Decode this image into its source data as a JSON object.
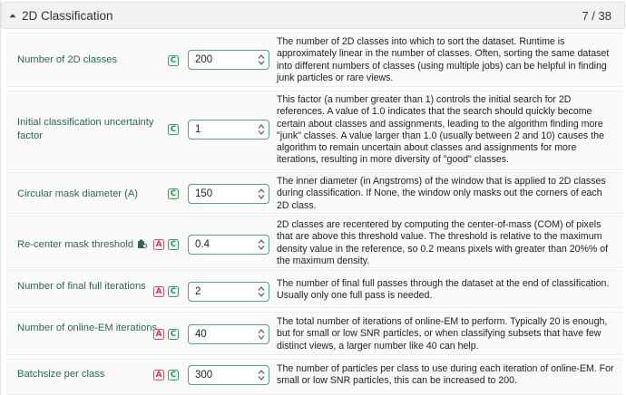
{
  "section": {
    "title": "2D Classification",
    "count": "7 / 38"
  },
  "params": [
    {
      "label": "Number of 2D classes",
      "value": "200",
      "badges": [
        "C"
      ],
      "description": "The number of 2D classes into which to sort the dataset. Runtime is approximately linear in the number of classes. Often, sorting the same dataset into different numbers of classes (using multiple jobs) can be helpful in finding junk particles or rare views."
    },
    {
      "label": "Initial classification uncertainty factor",
      "value": "1",
      "badges": [
        "C"
      ],
      "description": "This factor (a number greater than 1) controls the initial search for 2D references. A value of 1.0 indicates that the search should quickly become certain about classes and assignments, leading to the algorithm finding more \"junk\" classes. A value larger than 1.0 (usually between 2 and 10) causes the algorithm to remain uncertain about classes and assignments for more iterations, resulting in more diversity of \"good\" classes."
    },
    {
      "label": "Circular mask diameter (A)",
      "value": "150",
      "badges": [
        "C"
      ],
      "description": "The inner diameter (in Angstroms) of the window that is applied to 2D classes during classification. If None, the window only masks out the corners of each 2D class."
    },
    {
      "label": "Re-center mask threshold",
      "value": "0.4",
      "badges": [
        "A",
        "C"
      ],
      "description": "2D classes are recentered by computing the center-of-mass (COM) of pixels that are above this threshold value. The threshold is relative to the maximum density value in the reference, so 0.2 means pixels with greater than 20%% of the maximum density."
    },
    {
      "label": "Number of final full iterations",
      "value": "2",
      "badges": [
        "A",
        "C"
      ],
      "description": "The number of final full passes through the dataset at the end of classification. Usually only one full pass is needed."
    },
    {
      "label": "Number of online-EM iterations",
      "value": "40",
      "badges": [
        "A",
        "C"
      ],
      "description": "The total number of iterations of online-EM to perform. Typically 20 is enough, but for small or low SNR particles, or when classifying subsets that have few distinct views, a larger number like 40 can help."
    },
    {
      "label": "Batchsize per class",
      "value": "300",
      "badges": [
        "A",
        "C"
      ],
      "description": "The number of particles per class to use during each iteration of online-EM. For small or low SNR particles, this can be increased to 200."
    }
  ],
  "colors": {
    "label_green": "#2c6a4b",
    "badge_c": "#2e8b50",
    "badge_a": "#c83a55",
    "input_border": "#58a874"
  },
  "icons": {
    "collapse": "caret-up-icon",
    "recenter": "target-icon"
  }
}
